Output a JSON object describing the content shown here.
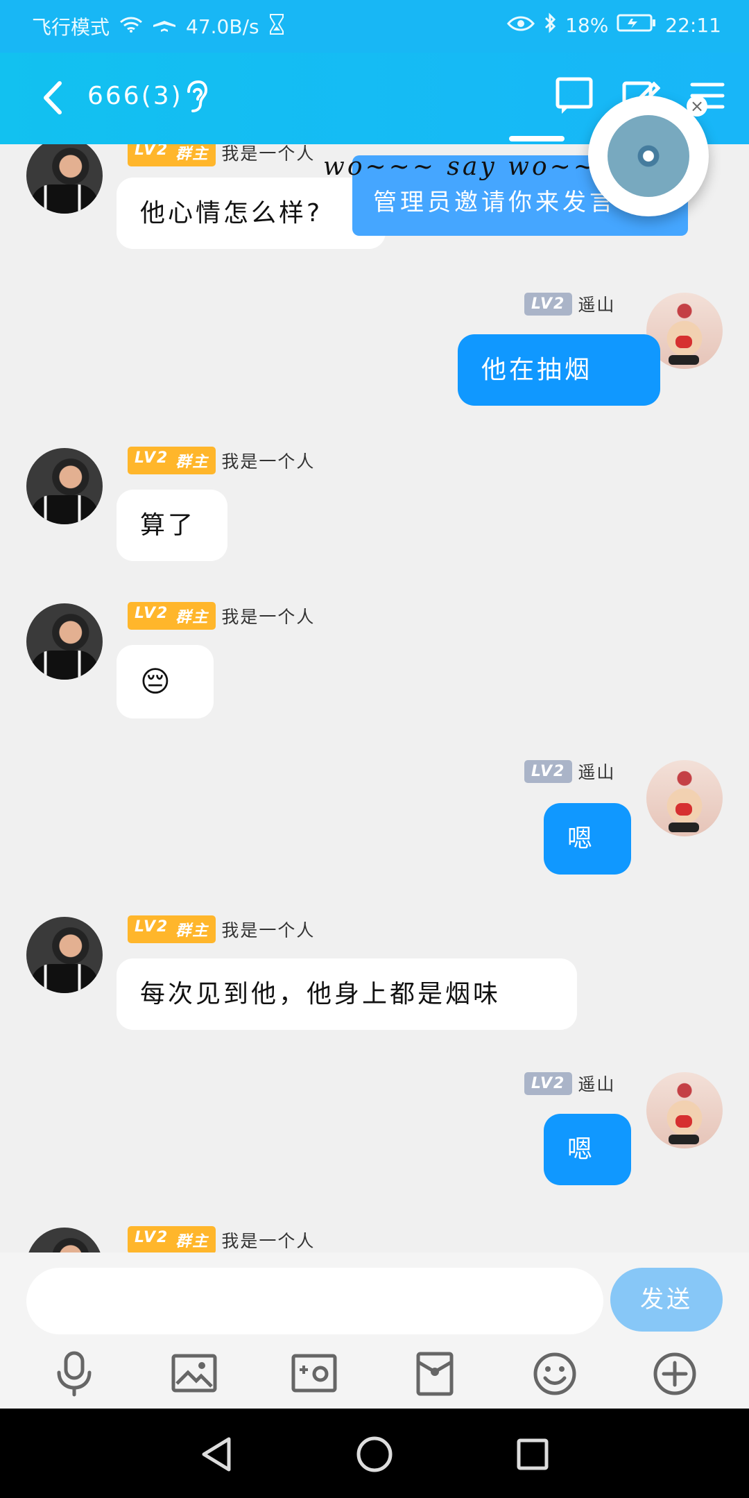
{
  "status": {
    "left": [
      "飞行模式",
      "47.0B/s"
    ],
    "right": [
      "18%",
      "22:11"
    ]
  },
  "header": {
    "title": "666(3)"
  },
  "banner": {
    "text": "管理员邀请你来发言"
  },
  "lyric": {
    "text": "wo~~~ say wo~~~"
  },
  "messages": [
    {
      "side": "left",
      "name": "我是一个人",
      "level": "LV2",
      "role": "群主",
      "text": "他心情怎么样?"
    },
    {
      "side": "right",
      "name": "遥山",
      "level": "LV2",
      "text": "他在抽烟"
    },
    {
      "side": "left",
      "name": "我是一个人",
      "level": "LV2",
      "role": "群主",
      "text": "算了"
    },
    {
      "side": "left",
      "name": "我是一个人",
      "level": "LV2",
      "role": "群主",
      "text": "😔"
    },
    {
      "side": "right",
      "name": "遥山",
      "level": "LV2",
      "text": "嗯"
    },
    {
      "side": "left",
      "name": "我是一个人",
      "level": "LV2",
      "role": "群主",
      "text": "每次见到他，他身上都是烟味"
    },
    {
      "side": "right",
      "name": "遥山",
      "level": "LV2",
      "text": "嗯"
    },
    {
      "side": "left",
      "name": "我是一个人",
      "level": "LV2",
      "role": "群主",
      "text": ""
    }
  ],
  "composer": {
    "value": "",
    "send": "发送"
  },
  "toolbar": [
    "microphone-icon",
    "image-icon",
    "camera-icon",
    "red-packet-icon",
    "smile-icon",
    "plus-icon"
  ],
  "colors": {
    "primary": "#18b7f5",
    "bubble_blue": "#1098ff",
    "level_gold": "#ffb62b",
    "level_gray": "#aab4c8"
  }
}
